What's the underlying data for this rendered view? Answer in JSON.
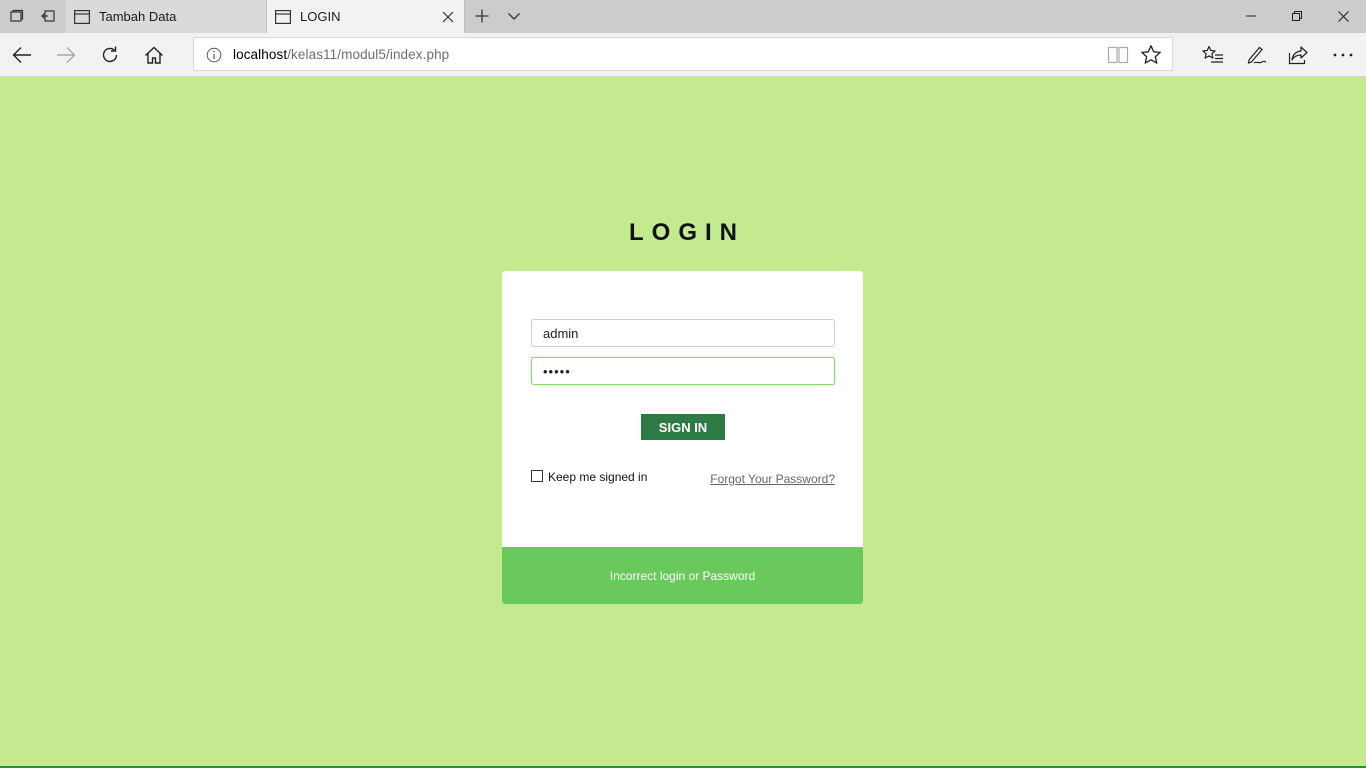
{
  "browser": {
    "tabs": [
      {
        "title": "Tambah Data",
        "active": false
      },
      {
        "title": "LOGIN",
        "active": true
      }
    ],
    "address": {
      "host": "localhost",
      "path": "/kelas11/modul5/index.php"
    }
  },
  "page": {
    "heading": "LOGIN",
    "username_value": "admin",
    "password_mask": "•••••",
    "sign_in_label": "SIGN IN",
    "keep_signed_in_label": "Keep me signed in",
    "forgot_label": "Forgot Your Password?",
    "error_message": "Incorrect login or Password"
  },
  "colors": {
    "page_background": "#c3ea8e",
    "button": "#2d7a45",
    "message_bar": "#6ac95c"
  }
}
